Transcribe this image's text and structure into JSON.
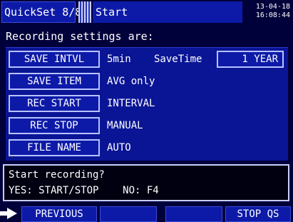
{
  "header": {
    "title": "QuickSet 8/8",
    "section": "Start",
    "date": "13-04-18",
    "time": "16:08:44"
  },
  "subtitle": "Recording settings are:",
  "settings": [
    {
      "label": "SAVE INTVL",
      "value": "5min"
    },
    {
      "label": "SAVE ITEM",
      "value": "AVG only"
    },
    {
      "label": "REC START",
      "value": "INTERVAL"
    },
    {
      "label": "REC STOP",
      "value": "MANUAL"
    },
    {
      "label": "FILE NAME",
      "value": "AUTO"
    }
  ],
  "savetime": {
    "label": "SaveTime",
    "value": "1 YEAR"
  },
  "prompt": {
    "line1": "Start recording?",
    "line2": "YES: START/STOP    NO: F4"
  },
  "softkeys": {
    "f1": "PREVIOUS",
    "f2": "",
    "f3": "",
    "f4": "STOP QS"
  },
  "colors": {
    "background": "#00003a",
    "panel": "#0a1596",
    "button": "#0d1aa8",
    "border": "#b8c2ff"
  }
}
